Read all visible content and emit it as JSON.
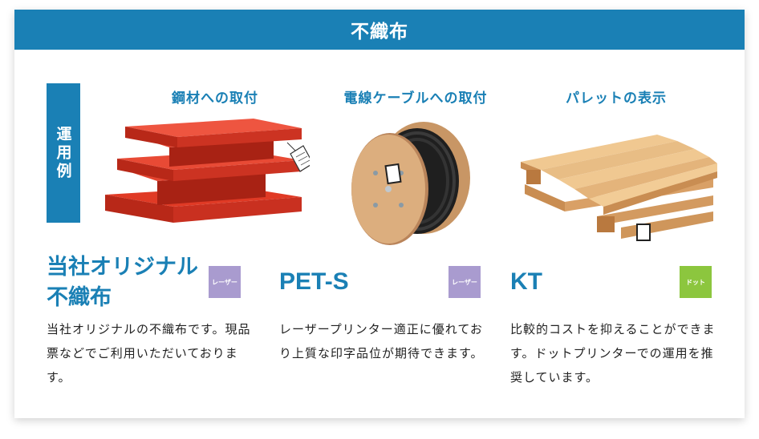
{
  "header": {
    "title": "不織布"
  },
  "usage": {
    "label": "運用例"
  },
  "applications": [
    {
      "caption": "鋼材への取付",
      "illustration": "red-steel-beams-with-tag"
    },
    {
      "caption": "電線ケーブルへの取付",
      "illustration": "wooden-cable-reel-with-tag"
    },
    {
      "caption": "パレットの表示",
      "illustration": "wooden-pallet-with-tag"
    }
  ],
  "products": [
    {
      "name": "当社オリジナル\n不織布",
      "badge": "レーザー",
      "badge_color": "#a99bcf",
      "description": "当社オリジナルの不織布です。現品票などでご利用いただいております。"
    },
    {
      "name": "PET-S",
      "badge": "レーザー",
      "badge_color": "#a99bcf",
      "description": "レーザープリンター適正に優れており上質な印字品位が期待できます。"
    },
    {
      "name": "KT",
      "badge": "ドット",
      "badge_color": "#8cc63e",
      "description": "比較的コストを抑えることができます。ドットプリンターでの運用を推奨しています。"
    }
  ],
  "colors": {
    "accent": "#1a80b5",
    "laser_badge": "#a99bcf",
    "dot_badge": "#8cc63e"
  }
}
